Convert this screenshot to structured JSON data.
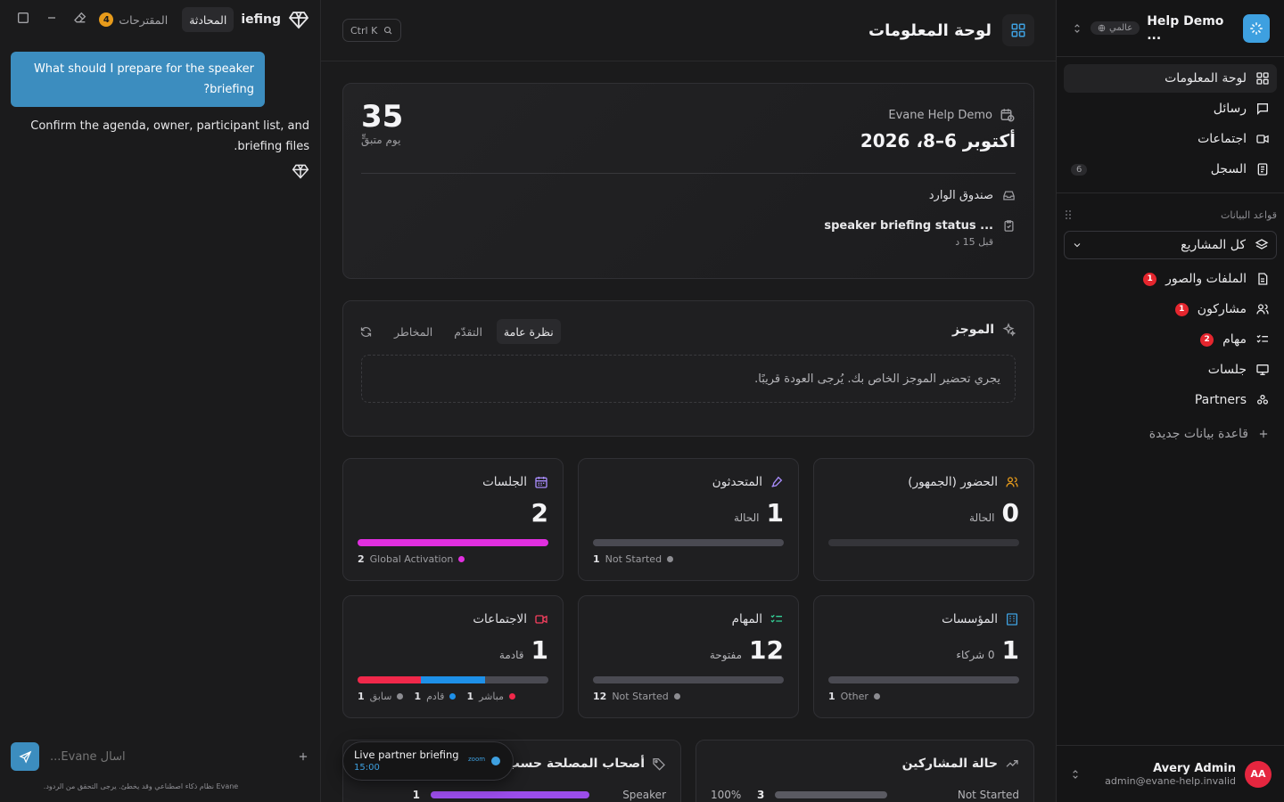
{
  "chat": {
    "title_fragment": "iefing",
    "tab_conversation": "المحادثة",
    "tab_suggestions": "المقترحات",
    "suggestions_count": "4",
    "user_message": "What should I prepare for the speaker briefing?",
    "assistant_message": "Confirm the agenda, owner, participant list, and briefing files.",
    "input_placeholder": "اسأل Evane...",
    "disclaimer": "Evane نظام ذكاء اصطناعي وقد يخطئ. يرجى التحقق من الردود."
  },
  "header": {
    "title": "لوحة المعلومات",
    "shortcut": "Ctrl K"
  },
  "event_card": {
    "countdown_value": "35",
    "countdown_label": "يوم متبقٍّ",
    "org_name": "Evane Help Demo",
    "date_range": "أكتوبر 6–8، 2026",
    "inbox_label": "صندوق الوارد",
    "inbox_item_title": "speaker briefing status ...",
    "inbox_item_time": "قبل 15 د"
  },
  "brief_card": {
    "title": "الموجز",
    "tabs": [
      "نظرة عامة",
      "التقدّم",
      "المخاطر"
    ],
    "active_tab": 0,
    "placeholder": "يجري تحضير الموجز الخاص بك. يُرجى العودة قريبًا."
  },
  "stats": [
    {
      "title": "الحضور (الجمهور)",
      "icon": "users-icon",
      "icon_color": "#e79b1b",
      "value": "0",
      "value_label": "الحالة",
      "segments": [],
      "legend": []
    },
    {
      "title": "المتحدثون",
      "icon": "microphone-icon",
      "icon_color": "#a78bfa",
      "value": "1",
      "value_label": "الحالة",
      "segments": [
        {
          "pct": 100,
          "color": "#4a4a52"
        }
      ],
      "legend": [
        {
          "count": "1",
          "label": "Not Started",
          "color": "#8d8d92"
        }
      ]
    },
    {
      "title": "الجلسات",
      "icon": "calendar-icon",
      "icon_color": "#a78bfa",
      "value": "2",
      "value_label": "",
      "segments": [
        {
          "pct": 100,
          "color": "#e12fe0"
        }
      ],
      "legend": [
        {
          "count": "2",
          "label": "Global Activation",
          "color": "#e12fe0"
        }
      ]
    },
    {
      "title": "المؤسسات",
      "icon": "building-icon",
      "icon_color": "#3ea0e0",
      "value": "1",
      "value_label": "0 شركاء",
      "segments": [
        {
          "pct": 100,
          "color": "#4a4a52"
        }
      ],
      "legend": [
        {
          "count": "1",
          "label": "Other",
          "color": "#8d8d92"
        }
      ]
    },
    {
      "title": "المهام",
      "icon": "checklist-icon",
      "icon_color": "#34d399",
      "value": "12",
      "value_label": "مفتوحة",
      "segments": [
        {
          "pct": 100,
          "color": "#4a4a52"
        }
      ],
      "legend": [
        {
          "count": "12",
          "label": "Not Started",
          "color": "#8d8d92"
        }
      ]
    },
    {
      "title": "الاجتماعات",
      "icon": "video-icon",
      "icon_color": "#f43f5e",
      "value": "1",
      "value_label": "قادمة",
      "segments": [
        {
          "pct": 33.3,
          "color": "#f0284a"
        },
        {
          "pct": 33.3,
          "color": "#1e90e8"
        },
        {
          "pct": 33.4,
          "color": "#4a4a52"
        }
      ],
      "legend": [
        {
          "count": "1",
          "label": "مباشر",
          "color": "#f0284a"
        },
        {
          "count": "1",
          "label": "قادم",
          "color": "#1e90e8"
        },
        {
          "count": "1",
          "label": "سابق",
          "color": "#8d8d92"
        }
      ]
    }
  ],
  "participants_card": {
    "title": "حالة المشاركين",
    "row_label": "Not Started",
    "row_count": "3",
    "row_percent": "100%",
    "row_fill": 100
  },
  "stakeholders_card": {
    "title": "أصحاب المصلحة حسب الن",
    "row_label": "Speaker",
    "row_count": "1",
    "row_fill": 100,
    "row_color": "#9b4dea"
  },
  "live_popup": {
    "title": "Live partner briefing",
    "time": "15:00",
    "platform": "zoom"
  },
  "sidebar": {
    "app_name": "Help Demo ...",
    "scope": "عالمي",
    "nav": [
      {
        "label": "لوحة المعلومات",
        "icon": "dashboard-icon",
        "active": true,
        "count": ""
      },
      {
        "label": "رسائل",
        "icon": "message-icon",
        "active": false,
        "count": ""
      },
      {
        "label": "اجتماعات",
        "icon": "video-icon",
        "active": false,
        "count": ""
      },
      {
        "label": "السجل",
        "icon": "log-icon",
        "active": false,
        "count": "6"
      }
    ],
    "databases_label": "قواعد البيانات",
    "project_select": "كل المشاريع",
    "databases": [
      {
        "label": "الملفات والصور",
        "icon": "file-icon",
        "badge": "1"
      },
      {
        "label": "مشاركون",
        "icon": "users-icon",
        "badge": "1"
      },
      {
        "label": "مهام",
        "icon": "checklist-icon",
        "badge": "2"
      },
      {
        "label": "جلسات",
        "icon": "presentation-icon",
        "badge": ""
      },
      {
        "label": "Partners",
        "icon": "partners-icon",
        "badge": ""
      }
    ],
    "new_database": "قاعدة بيانات جديدة",
    "user": {
      "name": "Avery Admin",
      "email": "admin@evane-help.invalid",
      "initials": "AA"
    }
  }
}
